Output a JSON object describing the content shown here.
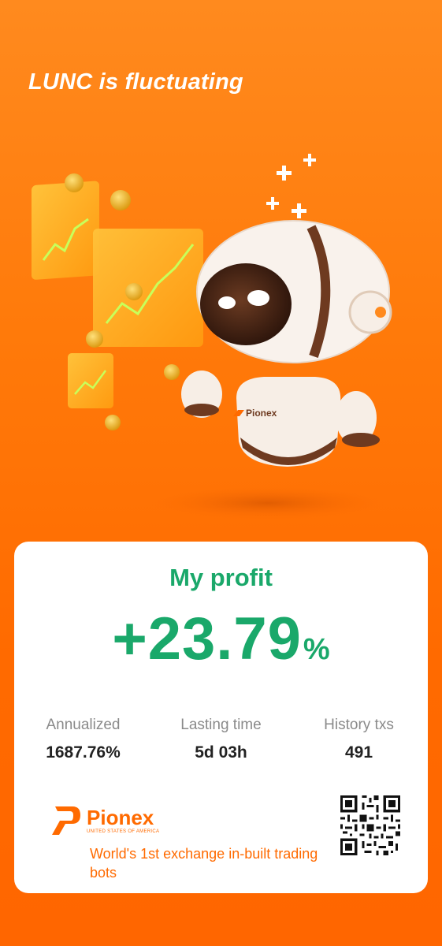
{
  "header": {
    "title": "LUNC is fluctuating"
  },
  "hero": {
    "robot_badge": "Pionex"
  },
  "profit": {
    "label": "My profit",
    "value": "+23.79",
    "unit": "%"
  },
  "stats": [
    {
      "label": "Annualized",
      "value": "1687.76%"
    },
    {
      "label": "Lasting time",
      "value": "5d 03h"
    },
    {
      "label": "History txs",
      "value": "491"
    }
  ],
  "brand": {
    "name": "Pionex",
    "subtitle": "UNITED STATES OF AMERICA",
    "tagline": "World's 1st exchange in-built trading bots"
  },
  "colors": {
    "accent_orange": "#ff6a00",
    "profit_green": "#1aa86a"
  }
}
